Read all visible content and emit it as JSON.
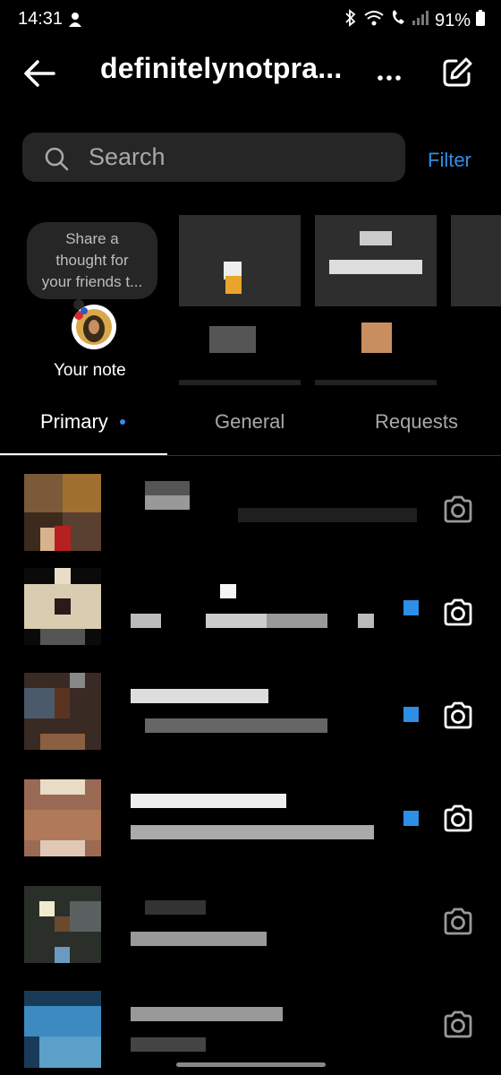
{
  "status": {
    "time": "14:31",
    "battery": "91%"
  },
  "header": {
    "title": "definitelynotpra..."
  },
  "search": {
    "placeholder": "Search",
    "filter_label": "Filter"
  },
  "notes": {
    "bubble_text_1": "Share a",
    "bubble_text_2": "thought for",
    "bubble_text_3": "your friends t...",
    "your_note_label": "Your note"
  },
  "tabs": [
    {
      "label": "Primary",
      "active": true
    },
    {
      "label": "General",
      "active": false
    },
    {
      "label": "Requests",
      "active": false
    }
  ],
  "conversations": [
    {
      "unread": false
    },
    {
      "unread": true
    },
    {
      "unread": true
    },
    {
      "unread": true
    },
    {
      "unread": false
    },
    {
      "unread": false
    }
  ],
  "colors": {
    "accent": "#2d8fe6",
    "search_bg": "#262626"
  }
}
